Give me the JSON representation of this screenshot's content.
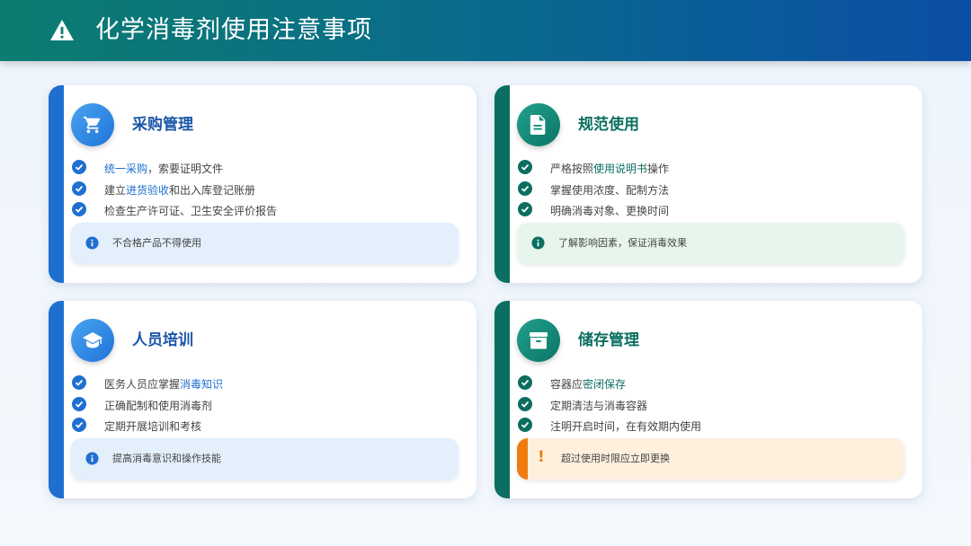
{
  "header": {
    "title": "化学消毒剂使用注意事项",
    "icon": "warning-icon"
  },
  "colors": {
    "blue": "#1f6fd0",
    "green": "#0b6e60",
    "orange": "#f07c10"
  },
  "cards": [
    {
      "title": "采购管理",
      "icon": "cart-icon",
      "items": [
        {
          "hl": "统一采购",
          "after": "，索要证明文件"
        },
        {
          "before": "建立",
          "hl": "进货验收",
          "after": "和出入库登记账册"
        },
        {
          "before": "检查生产许可证、卫生安全评价报告"
        }
      ],
      "note": "不合格产品不得使用"
    },
    {
      "title": "规范使用",
      "icon": "document-icon",
      "items": [
        {
          "before": "严格按照",
          "hl": "使用说明书",
          "after": "操作"
        },
        {
          "before": "掌握使用浓度、配制方法"
        },
        {
          "before": "明确消毒对象、更换时间"
        }
      ],
      "note": "了解影响因素，保证消毒效果"
    },
    {
      "title": "人员培训",
      "icon": "graduation-cap-icon",
      "items": [
        {
          "before": "医务人员应掌握",
          "hl": "消毒知识"
        },
        {
          "before": "正确配制和使用消毒剂"
        },
        {
          "before": "定期开展培训和考核"
        }
      ],
      "note": "提高消毒意识和操作技能"
    },
    {
      "title": "储存管理",
      "icon": "archive-box-icon",
      "items": [
        {
          "before": "容器应",
          "hl": "密闭保存"
        },
        {
          "before": "定期清洁与消毒容器"
        },
        {
          "before": "注明开启时间，在有效期内使用"
        }
      ],
      "note": "超过使用时限应立即更换",
      "note_mark": "!"
    }
  ]
}
